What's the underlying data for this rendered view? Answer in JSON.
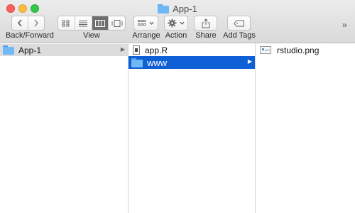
{
  "window": {
    "title": "App-1"
  },
  "toolbar": {
    "back_forward_label": "Back/Forward",
    "view_label": "View",
    "arrange_label": "Arrange",
    "action_label": "Action",
    "share_label": "Share",
    "add_tags_label": "Add Tags",
    "overflow": "»"
  },
  "columns": [
    {
      "items": [
        {
          "name": "App-1",
          "kind": "folder",
          "state": "selected-inactive"
        }
      ]
    },
    {
      "items": [
        {
          "name": "app.R",
          "kind": "file"
        },
        {
          "name": "www",
          "kind": "folder",
          "state": "selected-active"
        }
      ]
    },
    {
      "items": [
        {
          "name": "rstudio.png",
          "kind": "image"
        }
      ]
    }
  ],
  "colors": {
    "selection": "#0f5fd6",
    "folder": "#70b8f6",
    "inactive_selection": "#dcdcdc"
  }
}
